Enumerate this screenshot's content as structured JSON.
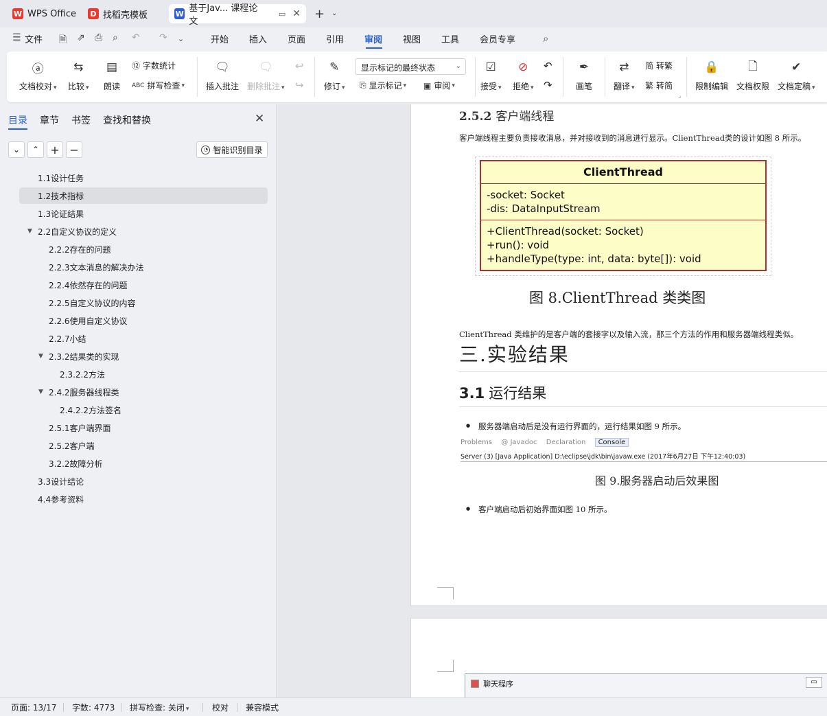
{
  "tabs": [
    {
      "label": "WPS Office",
      "icon": "wps-logo-icon",
      "color": "#e83a30"
    },
    {
      "label": "找稻壳模板",
      "icon": "docer-icon",
      "color": "#e83a30"
    },
    {
      "label": "基于Jav... 课程论文",
      "icon": "word-doc-icon",
      "color": "#2b5fd9"
    }
  ],
  "menubar": {
    "file": "文件",
    "items": [
      "开始",
      "插入",
      "页面",
      "引用",
      "审阅",
      "视图",
      "工具",
      "会员专享"
    ],
    "active": "审阅"
  },
  "ribbon": {
    "proofread": "文档校对",
    "compare": "比较",
    "read_aloud": "朗读",
    "word_count": "字数统计",
    "spell_check": "拼写检查",
    "insert_comment": "插入批注",
    "delete_comment": "删除批注",
    "revise": "修订",
    "markup_state": "显示标记的最终状态",
    "show_markup": "显示标记",
    "review": "审阅",
    "accept": "接受",
    "reject": "拒绝",
    "pen": "画笔",
    "translate": "翻译",
    "to_traditional": "转繁",
    "to_simplified": "转简",
    "restrict_edit": "限制编辑",
    "doc_rights": "文档权限",
    "doc_finalize": "文档定稿"
  },
  "sidebar": {
    "tabs": [
      "目录",
      "章节",
      "书签",
      "查找和替换"
    ],
    "smart_toc": "智能识别目录",
    "toc": [
      {
        "label": "1.1设计任务",
        "level": 1,
        "selected": false
      },
      {
        "label": "1.2技术指标",
        "level": 1,
        "selected": true
      },
      {
        "label": "1.3论证结果",
        "level": 1,
        "selected": false
      },
      {
        "label": "2.2自定义协议的定义",
        "level": 1,
        "selected": false,
        "expanded": true
      },
      {
        "label": "2.2.2存在的问题",
        "level": 2,
        "selected": false
      },
      {
        "label": "2.2.3文本消息的解决办法",
        "level": 2,
        "selected": false
      },
      {
        "label": "2.2.4依然存在的问题",
        "level": 2,
        "selected": false
      },
      {
        "label": "2.2.5自定义协议的内容",
        "level": 2,
        "selected": false
      },
      {
        "label": "2.2.6使用自定义协议",
        "level": 2,
        "selected": false
      },
      {
        "label": "2.2.7小结",
        "level": 2,
        "selected": false
      },
      {
        "label": "2.3.2结果类的实现",
        "level": 2,
        "selected": false,
        "expanded": true
      },
      {
        "label": "2.3.2.2方法",
        "level": 3,
        "selected": false
      },
      {
        "label": "2.4.2服务器线程类",
        "level": 2,
        "selected": false,
        "expanded": true
      },
      {
        "label": "2.4.2.2方法签名",
        "level": 3,
        "selected": false
      },
      {
        "label": "2.5.1客户端界面",
        "level": 2,
        "selected": false
      },
      {
        "label": "2.5.2客户端",
        "level": 2,
        "selected": false
      },
      {
        "label": "3.2.2故障分析",
        "level": 2,
        "selected": false
      },
      {
        "label": "3.3设计结论",
        "level": 1,
        "selected": false
      },
      {
        "label": "4.4参考资料",
        "level": 1,
        "selected": false
      }
    ]
  },
  "document": {
    "heading_252_num": "2.5.2",
    "heading_252_text": "客户端线程",
    "para1": "客户端线程主要负责接收消息，并对接收到的消息进行显示。ClientThread类的设计如图 8 所示。",
    "uml": {
      "class_name": "ClientThread",
      "attr1": "-socket: Socket",
      "attr2": "-dis: DataInputStream",
      "method1": "+ClientThread(socket: Socket)",
      "method2": "+run(): void",
      "method3": "+handleType(type: int, data: byte[]): void"
    },
    "fig8_caption": "图 8.ClientThread 类类图",
    "para2": "ClientThread 类维护的是客户端的套接字以及输入流，那三个方法的作用和服务器端线程类似。",
    "heading_3": "三.实验结果",
    "heading_31_num": "3.1",
    "heading_31_text": "运行结果",
    "bullet1": "服务器端启动后是没有运行界面的，运行结果如图 9 所示。",
    "console_tabs": [
      "Problems",
      "@ Javadoc",
      "Declaration",
      "Console"
    ],
    "console_line": "Server (3) [Java Application] D:\\eclipse\\jdk\\bin\\javaw.exe (2017年6月27日 下午12:40:03)",
    "fig9_caption": "图 9.服务器启动后效果图",
    "bullet2": "客户端启动后初始界面如图 10 所示。",
    "chat_window_title": "聊天程序"
  },
  "status": {
    "page": "页面: 13/17",
    "words": "字数: 4773",
    "spell": "拼写检查: 关闭",
    "proof": "校对",
    "compat": "兼容模式"
  }
}
